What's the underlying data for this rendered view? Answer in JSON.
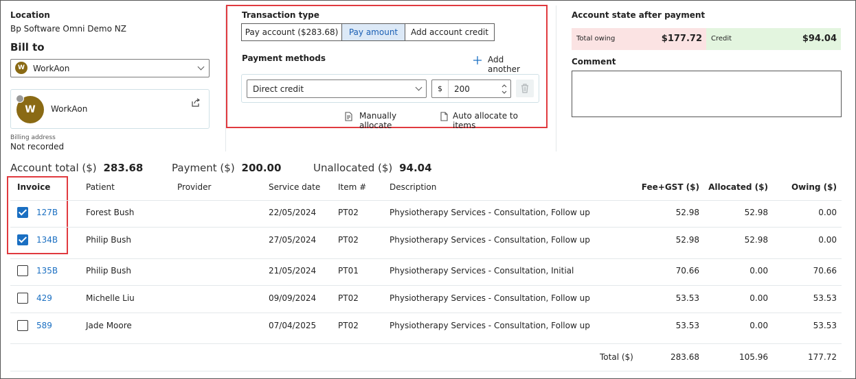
{
  "location": {
    "label": "Location",
    "value": "Bp Software Omni Demo NZ"
  },
  "bill_to": {
    "label": "Bill to",
    "selected": "WorkAon",
    "avatar_initial": "W",
    "card_name": "WorkAon",
    "billing_address_label": "Billing address",
    "billing_address_value": "Not recorded"
  },
  "transaction": {
    "label": "Transaction type",
    "options": [
      "Pay account ($283.68)",
      "Pay amount",
      "Add account credit"
    ],
    "active_index": 1
  },
  "payment_methods": {
    "label": "Payment methods",
    "add_another": "Add another",
    "method": "Direct credit",
    "currency_symbol": "$",
    "amount": "200",
    "manually_allocate": "Manually allocate",
    "auto_allocate": "Auto allocate to items"
  },
  "account_state": {
    "label": "Account state after payment",
    "total_owing_label": "Total owing",
    "total_owing_value": "$177.72",
    "credit_label": "Credit",
    "credit_value": "$94.04"
  },
  "comment": {
    "label": "Comment",
    "value": ""
  },
  "summary": {
    "account_total_label": "Account total ($)",
    "account_total_value": "283.68",
    "payment_label": "Payment ($)",
    "payment_value": "200.00",
    "unallocated_label": "Unallocated ($)",
    "unallocated_value": "94.04"
  },
  "table": {
    "headers": [
      "Invoice",
      "Patient",
      "Provider",
      "Service date",
      "Item #",
      "Description",
      "Fee+GST ($)",
      "Allocated ($)",
      "Owing ($)"
    ],
    "rows": [
      {
        "checked": true,
        "invoice": "127B",
        "patient": "Forest Bush",
        "provider": "",
        "date": "22/05/2024",
        "item": "PT02",
        "description": "Physiotherapy Services - Consultation, Follow up",
        "fee": "52.98",
        "allocated": "52.98",
        "owing": "0.00"
      },
      {
        "checked": true,
        "invoice": "134B",
        "patient": "Philip Bush",
        "provider": "",
        "date": "27/05/2024",
        "item": "PT02",
        "description": "Physiotherapy Services - Consultation, Follow up",
        "fee": "52.98",
        "allocated": "52.98",
        "owing": "0.00"
      },
      {
        "checked": false,
        "invoice": "135B",
        "patient": "Philip Bush",
        "provider": "",
        "date": "21/05/2024",
        "item": "PT01",
        "description": "Physiotherapy Services - Consultation, Initial",
        "fee": "70.66",
        "allocated": "0.00",
        "owing": "70.66"
      },
      {
        "checked": false,
        "invoice": "429",
        "patient": "Michelle Liu",
        "provider": "",
        "date": "09/09/2024",
        "item": "PT02",
        "description": "Physiotherapy Services - Consultation, Follow up",
        "fee": "53.53",
        "allocated": "0.00",
        "owing": "53.53"
      },
      {
        "checked": false,
        "invoice": "589",
        "patient": "Jade Moore",
        "provider": "",
        "date": "07/04/2025",
        "item": "PT02",
        "description": "Physiotherapy Services - Consultation, Follow up",
        "fee": "53.53",
        "allocated": "0.00",
        "owing": "53.53"
      }
    ],
    "total_label": "Total ($)",
    "total_fee": "283.68",
    "total_allocated": "105.96",
    "total_owing": "177.72"
  },
  "colors": {
    "accent": "#1a6fc2",
    "highlight_border": "#e0393e",
    "owing_bg": "#fbe3e3",
    "credit_bg": "#e3f5df",
    "avatar": "#8a6a14"
  }
}
